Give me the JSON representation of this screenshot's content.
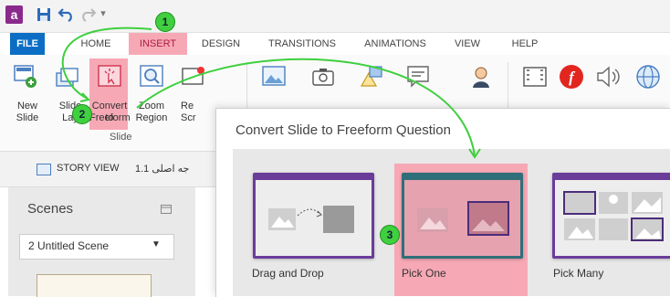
{
  "app": {
    "logo_letter": "a"
  },
  "quick_access": {
    "save_icon": "save-icon",
    "undo_icon": "undo-icon",
    "redo_icon": "redo-icon",
    "more_icon": "customize-qat-icon"
  },
  "tabs": [
    "FILE",
    "HOME",
    "INSERT",
    "DESIGN",
    "TRANSITIONS",
    "ANIMATIONS",
    "VIEW",
    "HELP"
  ],
  "active_tab": "INSERT",
  "ribbon": {
    "new_slide": [
      "New",
      "Slide"
    ],
    "slide_layers": [
      "Slide",
      "Lay"
    ],
    "convert": [
      "Convert to",
      "Freeform"
    ],
    "zoom": [
      "Zoom",
      "Region"
    ],
    "record": [
      "Re",
      "Scr"
    ],
    "truncated_labels": [
      "Pictur",
      "Screens",
      "Shape",
      "Caption",
      "Characte",
      "Video",
      "Flash",
      "Audio",
      "Web"
    ],
    "slide_group_label": "Slide"
  },
  "story": {
    "story_view": "STORY VIEW",
    "scene_tab": "1.1 جه اصلی"
  },
  "scenes": {
    "title": "Scenes",
    "selected": "2 Untitled Scene"
  },
  "dialog": {
    "title": "Convert Slide to Freeform Question",
    "options": [
      {
        "label": "Drag and Drop"
      },
      {
        "label": "Pick One"
      },
      {
        "label": "Pick Many"
      }
    ]
  },
  "steps": [
    "1",
    "2",
    "3"
  ],
  "colors": {
    "accent_pink": "#f6a9b5",
    "file_blue": "#0b6ec4",
    "step_green": "#3fcf3f",
    "card_purple": "#6a3c9a"
  }
}
